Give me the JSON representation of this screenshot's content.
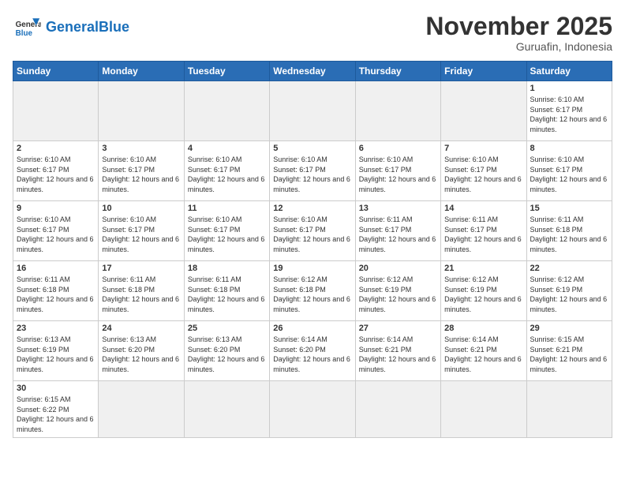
{
  "logo": {
    "text_general": "General",
    "text_blue": "Blue"
  },
  "title": "November 2025",
  "location": "Guruafin, Indonesia",
  "days_of_week": [
    "Sunday",
    "Monday",
    "Tuesday",
    "Wednesday",
    "Thursday",
    "Friday",
    "Saturday"
  ],
  "weeks": [
    [
      {
        "day": "",
        "info": ""
      },
      {
        "day": "",
        "info": ""
      },
      {
        "day": "",
        "info": ""
      },
      {
        "day": "",
        "info": ""
      },
      {
        "day": "",
        "info": ""
      },
      {
        "day": "",
        "info": ""
      },
      {
        "day": "1",
        "info": "Sunrise: 6:10 AM\nSunset: 6:17 PM\nDaylight: 12 hours and 6 minutes."
      }
    ],
    [
      {
        "day": "2",
        "info": "Sunrise: 6:10 AM\nSunset: 6:17 PM\nDaylight: 12 hours and 6 minutes."
      },
      {
        "day": "3",
        "info": "Sunrise: 6:10 AM\nSunset: 6:17 PM\nDaylight: 12 hours and 6 minutes."
      },
      {
        "day": "4",
        "info": "Sunrise: 6:10 AM\nSunset: 6:17 PM\nDaylight: 12 hours and 6 minutes."
      },
      {
        "day": "5",
        "info": "Sunrise: 6:10 AM\nSunset: 6:17 PM\nDaylight: 12 hours and 6 minutes."
      },
      {
        "day": "6",
        "info": "Sunrise: 6:10 AM\nSunset: 6:17 PM\nDaylight: 12 hours and 6 minutes."
      },
      {
        "day": "7",
        "info": "Sunrise: 6:10 AM\nSunset: 6:17 PM\nDaylight: 12 hours and 6 minutes."
      },
      {
        "day": "8",
        "info": "Sunrise: 6:10 AM\nSunset: 6:17 PM\nDaylight: 12 hours and 6 minutes."
      }
    ],
    [
      {
        "day": "9",
        "info": "Sunrise: 6:10 AM\nSunset: 6:17 PM\nDaylight: 12 hours and 6 minutes."
      },
      {
        "day": "10",
        "info": "Sunrise: 6:10 AM\nSunset: 6:17 PM\nDaylight: 12 hours and 6 minutes."
      },
      {
        "day": "11",
        "info": "Sunrise: 6:10 AM\nSunset: 6:17 PM\nDaylight: 12 hours and 6 minutes."
      },
      {
        "day": "12",
        "info": "Sunrise: 6:10 AM\nSunset: 6:17 PM\nDaylight: 12 hours and 6 minutes."
      },
      {
        "day": "13",
        "info": "Sunrise: 6:11 AM\nSunset: 6:17 PM\nDaylight: 12 hours and 6 minutes."
      },
      {
        "day": "14",
        "info": "Sunrise: 6:11 AM\nSunset: 6:17 PM\nDaylight: 12 hours and 6 minutes."
      },
      {
        "day": "15",
        "info": "Sunrise: 6:11 AM\nSunset: 6:18 PM\nDaylight: 12 hours and 6 minutes."
      }
    ],
    [
      {
        "day": "16",
        "info": "Sunrise: 6:11 AM\nSunset: 6:18 PM\nDaylight: 12 hours and 6 minutes."
      },
      {
        "day": "17",
        "info": "Sunrise: 6:11 AM\nSunset: 6:18 PM\nDaylight: 12 hours and 6 minutes."
      },
      {
        "day": "18",
        "info": "Sunrise: 6:11 AM\nSunset: 6:18 PM\nDaylight: 12 hours and 6 minutes."
      },
      {
        "day": "19",
        "info": "Sunrise: 6:12 AM\nSunset: 6:18 PM\nDaylight: 12 hours and 6 minutes."
      },
      {
        "day": "20",
        "info": "Sunrise: 6:12 AM\nSunset: 6:19 PM\nDaylight: 12 hours and 6 minutes."
      },
      {
        "day": "21",
        "info": "Sunrise: 6:12 AM\nSunset: 6:19 PM\nDaylight: 12 hours and 6 minutes."
      },
      {
        "day": "22",
        "info": "Sunrise: 6:12 AM\nSunset: 6:19 PM\nDaylight: 12 hours and 6 minutes."
      }
    ],
    [
      {
        "day": "23",
        "info": "Sunrise: 6:13 AM\nSunset: 6:19 PM\nDaylight: 12 hours and 6 minutes."
      },
      {
        "day": "24",
        "info": "Sunrise: 6:13 AM\nSunset: 6:20 PM\nDaylight: 12 hours and 6 minutes."
      },
      {
        "day": "25",
        "info": "Sunrise: 6:13 AM\nSunset: 6:20 PM\nDaylight: 12 hours and 6 minutes."
      },
      {
        "day": "26",
        "info": "Sunrise: 6:14 AM\nSunset: 6:20 PM\nDaylight: 12 hours and 6 minutes."
      },
      {
        "day": "27",
        "info": "Sunrise: 6:14 AM\nSunset: 6:21 PM\nDaylight: 12 hours and 6 minutes."
      },
      {
        "day": "28",
        "info": "Sunrise: 6:14 AM\nSunset: 6:21 PM\nDaylight: 12 hours and 6 minutes."
      },
      {
        "day": "29",
        "info": "Sunrise: 6:15 AM\nSunset: 6:21 PM\nDaylight: 12 hours and 6 minutes."
      }
    ],
    [
      {
        "day": "30",
        "info": "Sunrise: 6:15 AM\nSunset: 6:22 PM\nDaylight: 12 hours and 6 minutes."
      },
      {
        "day": "",
        "info": ""
      },
      {
        "day": "",
        "info": ""
      },
      {
        "day": "",
        "info": ""
      },
      {
        "day": "",
        "info": ""
      },
      {
        "day": "",
        "info": ""
      },
      {
        "day": "",
        "info": ""
      }
    ]
  ],
  "empty_first_row": [
    true,
    true,
    true,
    true,
    true,
    true,
    false
  ],
  "empty_last_row": [
    false,
    true,
    true,
    true,
    true,
    true,
    true
  ]
}
